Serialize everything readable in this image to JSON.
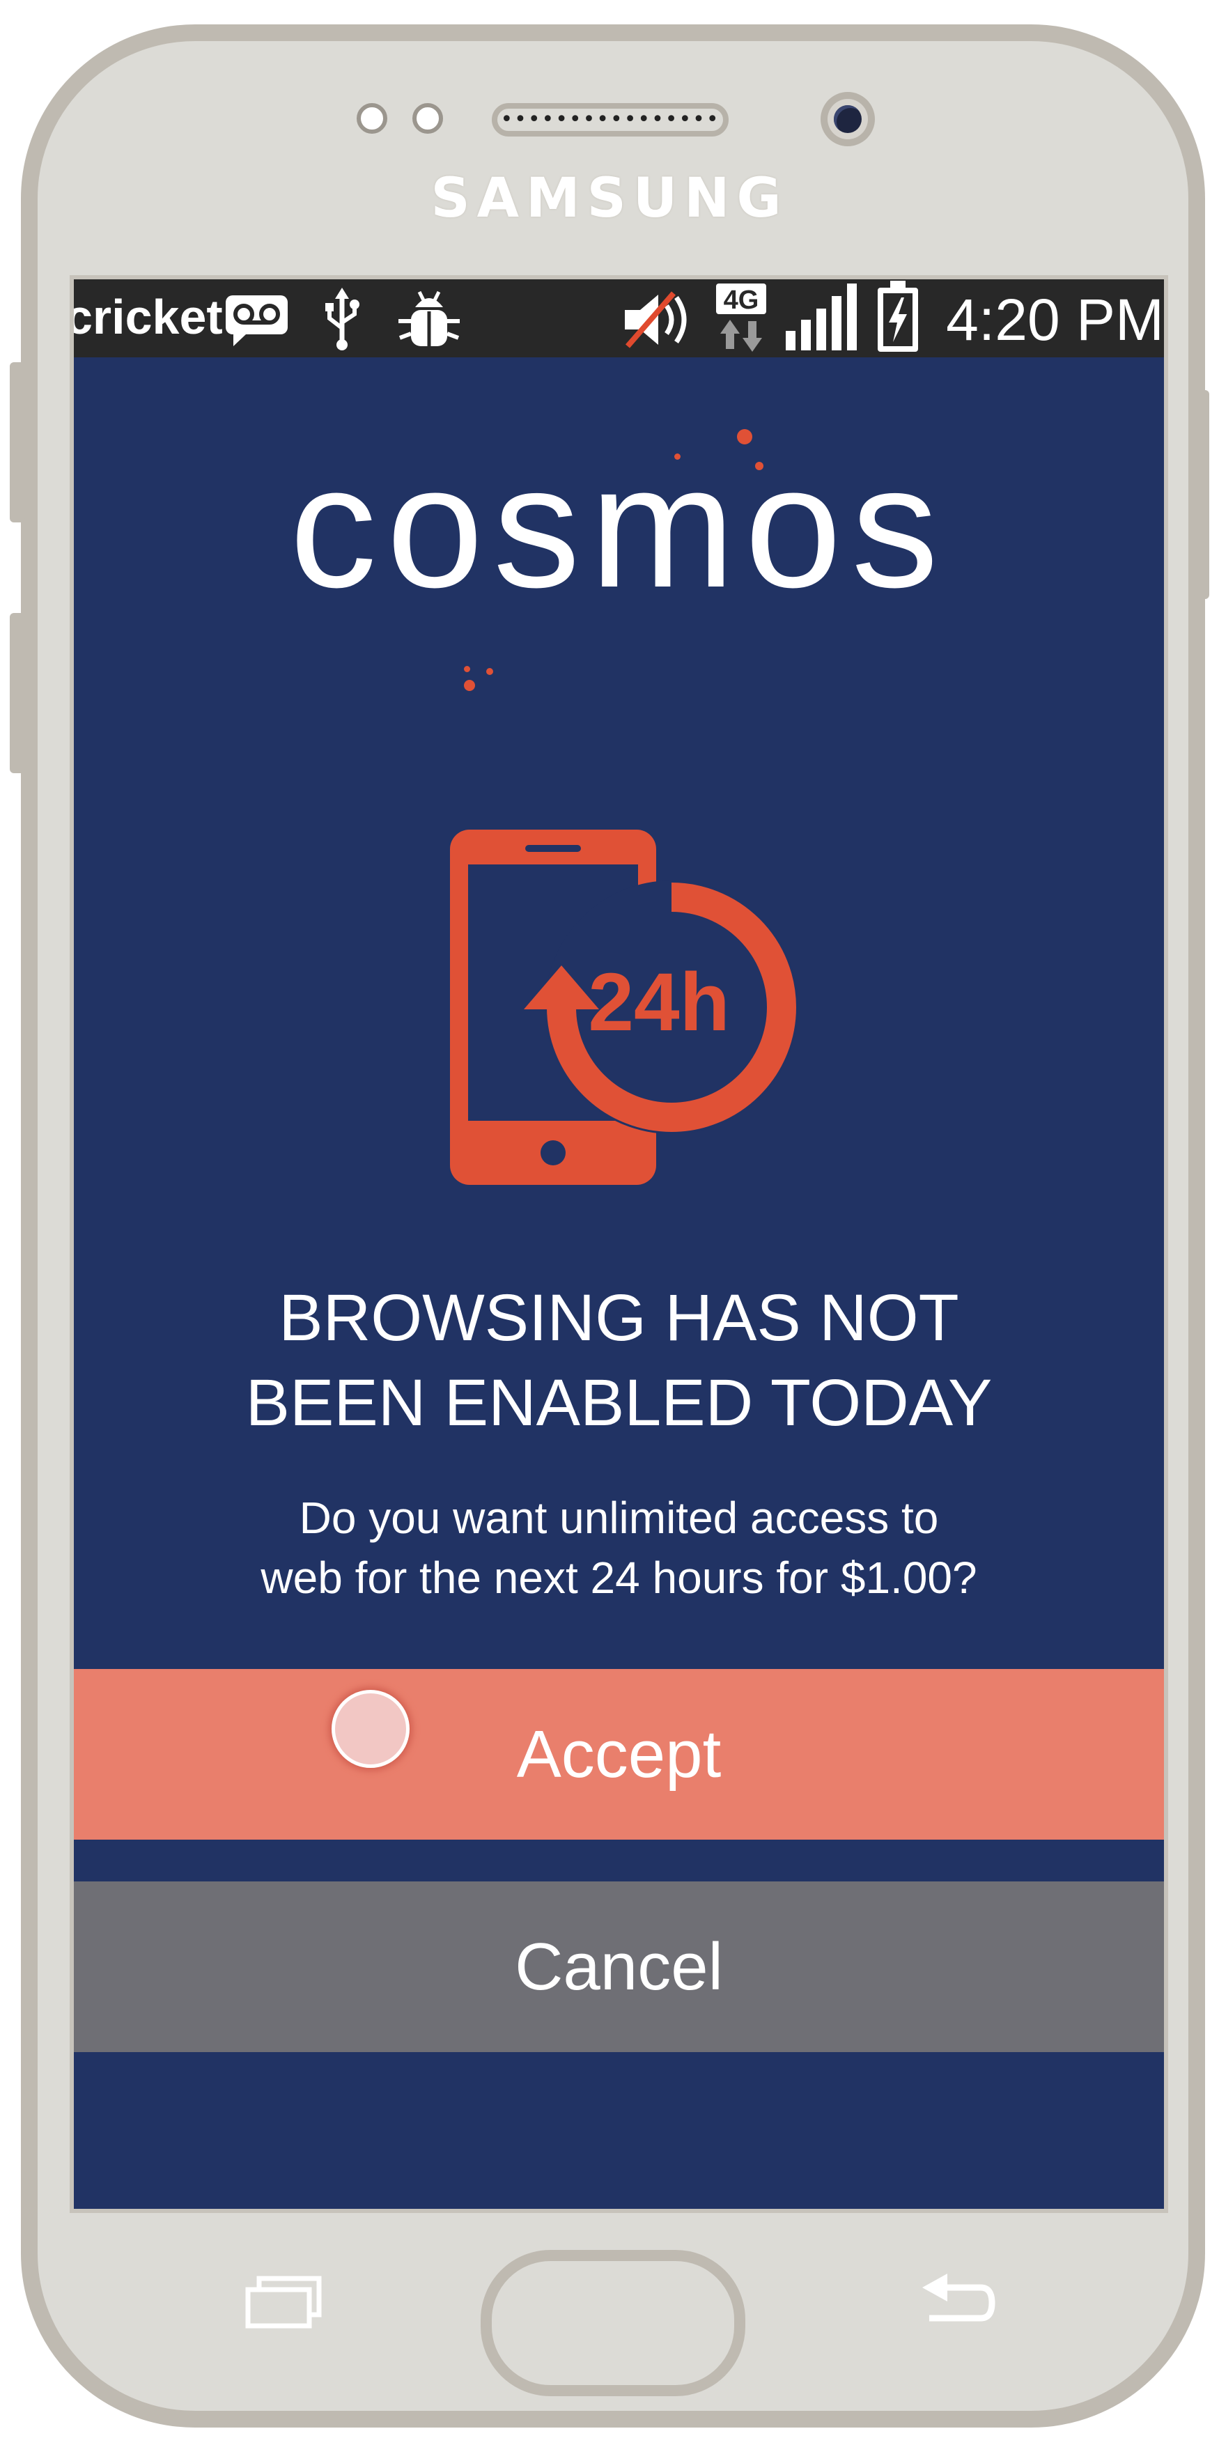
{
  "device": {
    "brand": "SAMSUNG",
    "speaker_grille": "••••••••••••••••",
    "colors": {
      "frame": "#dcdbd6",
      "bezel_border": "#bfbab1"
    }
  },
  "status_bar": {
    "carrier": "cricket",
    "network": "4G",
    "time": "4:20 PM",
    "icons": [
      "voicemail-icon",
      "usb-icon",
      "debug-bug-icon",
      "muted-volume-icon",
      "data-arrows-icon",
      "signal-bars-icon",
      "battery-charging-icon"
    ]
  },
  "app": {
    "logo_text": "cosmos",
    "hero_icon_label": "24h",
    "headline_line1": "BROWSING HAS NOT",
    "headline_line2": "BEEN ENABLED TODAY",
    "subtext_line1": "Do you want unlimited access to",
    "subtext_line2": "web for the next 24 hours for $1.00?",
    "accept_label": "Accept",
    "cancel_label": "Cancel",
    "colors": {
      "background": "#213364",
      "accent": "#e05136",
      "accept_button": "#e97f6c",
      "cancel_button": "#6f6f75",
      "text": "#ffffff"
    }
  },
  "nav_bar": {
    "icons": [
      "recent-apps-icon",
      "home-button",
      "back-icon"
    ]
  }
}
